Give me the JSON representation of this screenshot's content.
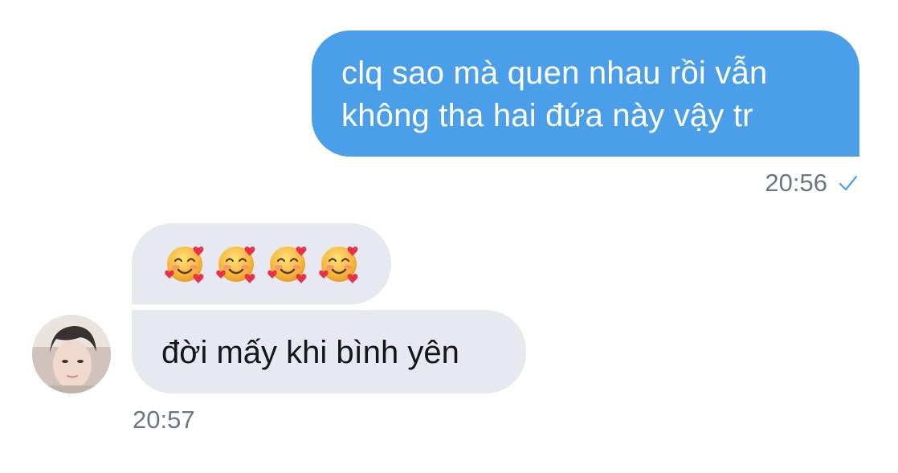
{
  "conversation": {
    "outgoing": {
      "lines": [
        "clq sao mà quen nhau rồi vẫn",
        "không tha hai đứa này vậy tr"
      ],
      "time": "20:56",
      "status_icon": "check-icon"
    },
    "incoming": {
      "emoji_count": 4,
      "emoji_icon": "smiling-face-with-hearts-icon",
      "text": "đời mấy khi bình yên",
      "time": "20:57",
      "avatar": "user-avatar"
    }
  },
  "colors": {
    "outgoing_bubble": "#4b9fe9",
    "incoming_bubble": "#e6e9ef",
    "timestamp": "#6a7682",
    "check": "#4b9fe9"
  }
}
